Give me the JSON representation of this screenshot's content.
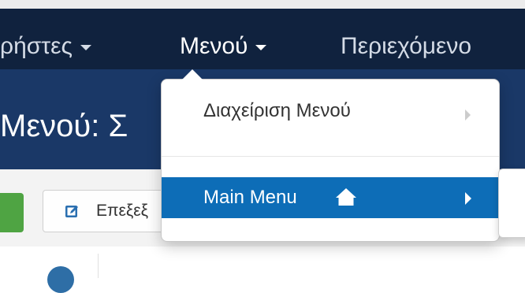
{
  "navbar": {
    "items": [
      {
        "label": "ρήστες"
      },
      {
        "label": "Μενού"
      },
      {
        "label": "Περιεχόμενο"
      }
    ]
  },
  "header": {
    "title": "Μενού: Σ"
  },
  "toolbar": {
    "edit_label": "Επεξεξ"
  },
  "dropdown": {
    "items": [
      {
        "label": "Διαχείριση Μενού"
      },
      {
        "label": "Main Menu"
      }
    ]
  },
  "icons": {
    "edit": "edit-icon",
    "home": "home-icon"
  },
  "colors": {
    "navbar": "#10223e",
    "header": "#1a3867",
    "active_item": "#0d6db7",
    "green_button": "#4fa443"
  }
}
